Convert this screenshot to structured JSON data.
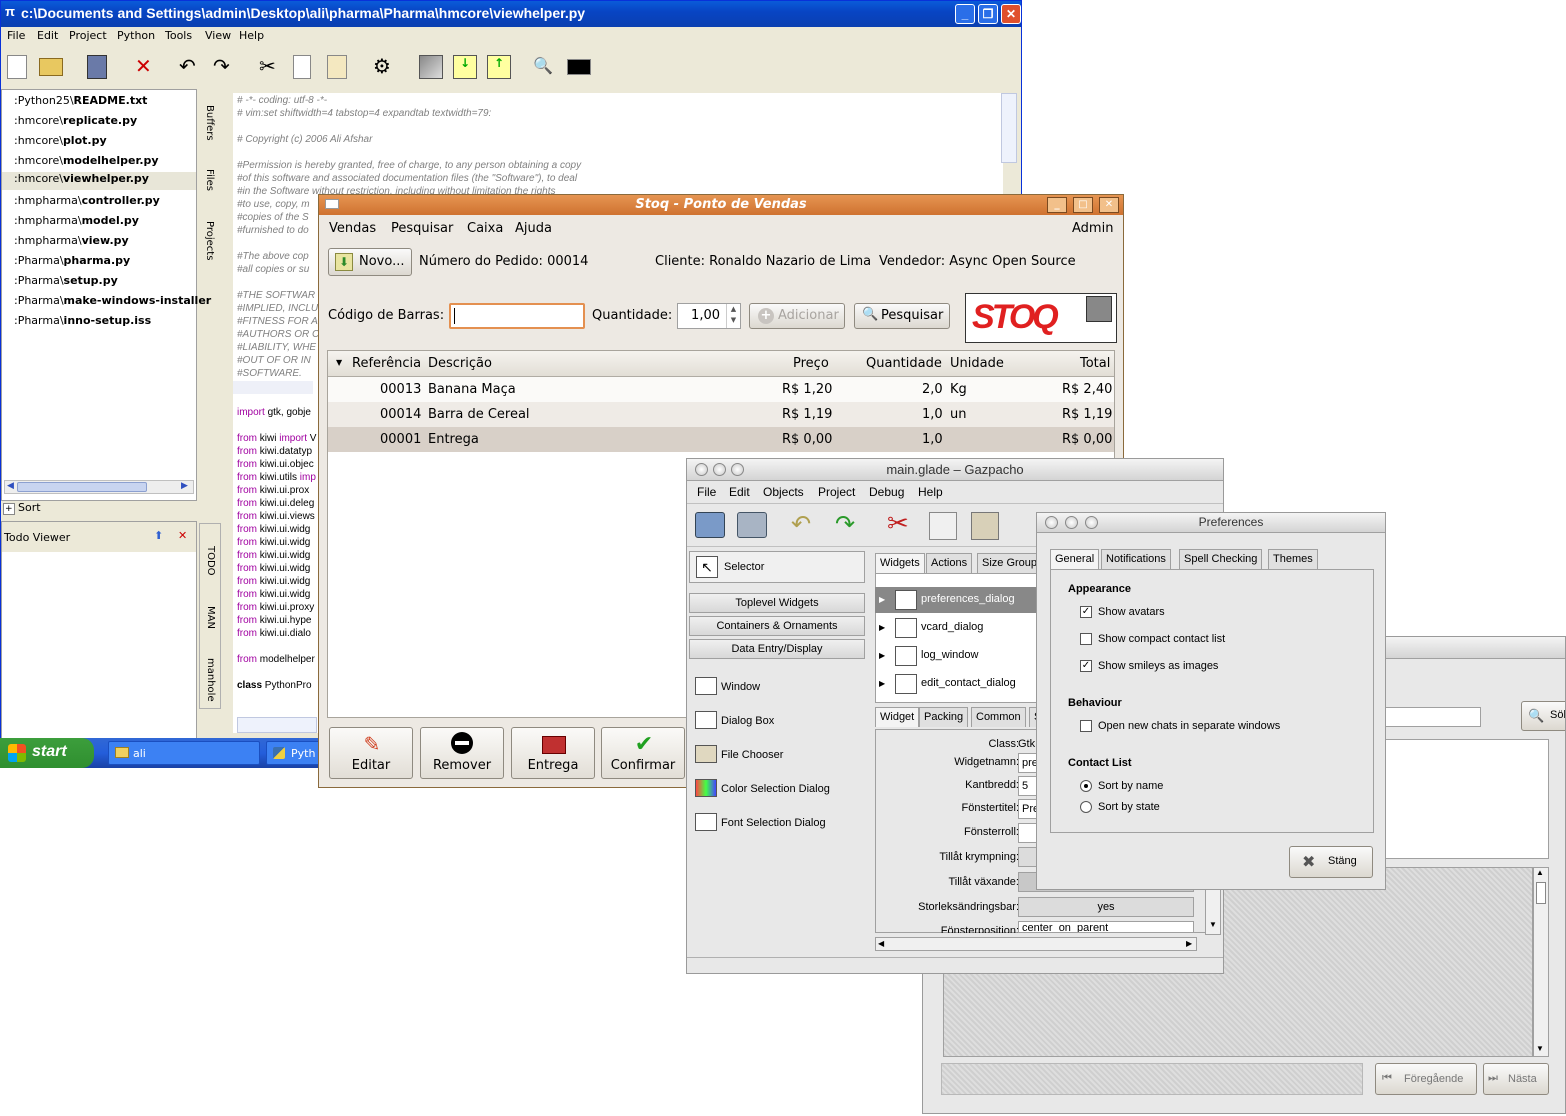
{
  "pida": {
    "title": "c:\\Documents and Settings\\admin\\Desktop\\ali\\pharma\\Pharma\\hmcore\\viewhelper.py",
    "menu": [
      "File",
      "Edit",
      "Project",
      "Python",
      "Tools",
      "View",
      "Help"
    ],
    "files": [
      {
        "dir": ":Python25\\",
        "name": "README.txt"
      },
      {
        "dir": ":hmcore\\",
        "name": "replicate.py"
      },
      {
        "dir": ":hmcore\\",
        "name": "plot.py"
      },
      {
        "dir": ":hmcore\\",
        "name": "modelhelper.py"
      },
      {
        "dir": ":hmcore\\",
        "name": "viewhelper.py"
      },
      {
        "dir": ":hmpharma\\",
        "name": "controller.py"
      },
      {
        "dir": ":hmpharma\\",
        "name": "model.py"
      },
      {
        "dir": ":hmpharma\\",
        "name": "view.py"
      },
      {
        "dir": ":Pharma\\",
        "name": "pharma.py"
      },
      {
        "dir": ":Pharma\\",
        "name": "setup.py"
      },
      {
        "dir": ":Pharma\\",
        "name": "make-windows-installer"
      },
      {
        "dir": ":Pharma\\",
        "name": "inno-setup.iss"
      }
    ],
    "side_tabs_top": [
      "Buffers",
      "Files",
      "Projects"
    ],
    "side_tabs_bottom": [
      "TODO",
      "MAN",
      "manhole"
    ],
    "sort_label": "Sort",
    "todo_title": "Todo Viewer",
    "code_lines": [
      "# -*- coding: utf-8 -*-",
      "# vim:set shiftwidth=4 tabstop=4 expandtab textwidth=79:",
      "",
      "# Copyright (c) 2006 Ali Afshar",
      "",
      "#Permission is hereby granted, free of charge, to any person obtaining a copy",
      "#of this software and associated documentation files (the \"Software\"), to deal",
      "#in the Software without restriction, including without limitation the rights",
      "#to use, copy, m",
      "#copies of the S",
      "#furnished to do",
      "",
      "#The above cop",
      "#all copies or su",
      "",
      "#THE SOFTWAR",
      "#IMPLIED, INCLU",
      "#FITNESS FOR A",
      "#AUTHORS OR C",
      "#LIABILITY, WHE",
      "#OUT OF OR IN",
      "#SOFTWARE."
    ],
    "import_lines": [
      {
        "kw": "import",
        "rest": " gtk, gobje"
      },
      {
        "kw": "",
        "rest": ""
      },
      {
        "kw": "from",
        "rest": " kiwi ",
        "kw2": "import",
        "rest2": " V"
      },
      {
        "kw": "from",
        "rest": " kiwi.datatyp"
      },
      {
        "kw": "from",
        "rest": " kiwi.ui.objec"
      },
      {
        "kw": "from",
        "rest": " kiwi.utils ",
        "kw2": "imp"
      },
      {
        "kw": "from",
        "rest": " kiwi.ui.prox"
      },
      {
        "kw": "from",
        "rest": " kiwi.ui.deleg"
      },
      {
        "kw": "from",
        "rest": " kiwi.ui.views"
      },
      {
        "kw": "from",
        "rest": " kiwi.ui.widg"
      },
      {
        "kw": "from",
        "rest": " kiwi.ui.widg"
      },
      {
        "kw": "from",
        "rest": " kiwi.ui.widg"
      },
      {
        "kw": "from",
        "rest": " kiwi.ui.widg"
      },
      {
        "kw": "from",
        "rest": " kiwi.ui.widg"
      },
      {
        "kw": "from",
        "rest": " kiwi.ui.widg"
      },
      {
        "kw": "from",
        "rest": " kiwi.ui.proxy"
      },
      {
        "kw": "from",
        "rest": " kiwi.ui.hype"
      },
      {
        "kw": "from",
        "rest": " kiwi.ui.dialo"
      },
      {
        "kw": "",
        "rest": ""
      },
      {
        "kw": "from",
        "rest": " modelhelper"
      },
      {
        "kw": "",
        "rest": ""
      },
      {
        "kw": "class",
        "rest": " PythonPro"
      }
    ]
  },
  "taskbar": {
    "start": "start",
    "items": [
      "ali",
      "Pyth"
    ]
  },
  "stoq": {
    "title": "Stoq - Ponto de Vendas",
    "menu": [
      "Vendas",
      "Pesquisar",
      "Caixa",
      "Ajuda"
    ],
    "admin": "Admin",
    "novo": "Novo...",
    "pedido": "Número do Pedido: 00014",
    "cliente": "Cliente: Ronaldo Nazario de Lima",
    "vendedor": "Vendedor: Async Open Source",
    "barcode_label": "Código de Barras:",
    "qty_label": "Quantidade:",
    "qty_value": "1,00",
    "adicionar": "Adicionar",
    "pesquisar": "Pesquisar",
    "logo": "STOQ",
    "columns": [
      "Referência",
      "Descrição",
      "Preço",
      "Quantidade",
      "Unidade",
      "Total"
    ],
    "rows": [
      {
        "ref": "00013",
        "desc": "Banana Maça",
        "preco": "R$ 1,20",
        "qtd": "2,0",
        "un": "Kg",
        "total": "R$ 2,40"
      },
      {
        "ref": "00014",
        "desc": "Barra de Cereal",
        "preco": "R$ 1,19",
        "qtd": "1,0",
        "un": "un",
        "total": "R$ 1,19"
      },
      {
        "ref": "00001",
        "desc": "Entrega",
        "preco": "R$ 0,00",
        "qtd": "1,0",
        "un": "",
        "total": "R$ 0,00"
      }
    ],
    "actions": [
      "Editar",
      "Remover",
      "Entrega",
      "Confirmar"
    ]
  },
  "glade": {
    "title": "main.glade – Gazpacho",
    "menu": [
      "File",
      "Edit",
      "Objects",
      "Project",
      "Debug",
      "Help"
    ],
    "selector": "Selector",
    "palette_groups": [
      "Toplevel Widgets",
      "Containers & Ornaments",
      "Data Entry/Display"
    ],
    "palette_items": [
      "Window",
      "Dialog Box",
      "File Chooser",
      "Color Selection Dialog",
      "Font Selection Dialog"
    ],
    "tree_tabs": [
      "Widgets",
      "Actions",
      "Size Group"
    ],
    "tree_items": [
      "preferences_dialog",
      "vcard_dialog",
      "log_window",
      "edit_contact_dialog"
    ],
    "editor_tabs": [
      "Widget",
      "Packing",
      "Common",
      "S"
    ],
    "properties": [
      {
        "label": "Class:",
        "value": "Gtk"
      },
      {
        "label": "Widgetnamn:",
        "value": "pre"
      },
      {
        "label": "Kantbredd:",
        "value": "5"
      },
      {
        "label": "Fönstertitel:",
        "value": "Pre"
      },
      {
        "label": "Fönsterroll:",
        "value": ""
      },
      {
        "label": "Tillåt krympning:",
        "value": ""
      },
      {
        "label": "Tillåt växande:",
        "value": ""
      },
      {
        "label": "Storleksändringsbar:",
        "value": "yes"
      },
      {
        "label": "Fönsterposition:",
        "value": "center_on_parent"
      }
    ]
  },
  "prefs": {
    "title": "Preferences",
    "tabs": [
      "General",
      "Notifications",
      "Spell Checking",
      "Themes"
    ],
    "appearance": "Appearance",
    "show_avatars": "Show avatars",
    "show_compact": "Show compact contact list",
    "show_smileys": "Show smileys as images",
    "behaviour": "Behaviour",
    "open_new": "Open new chats in separate windows",
    "contact_list": "Contact List",
    "sort_name": "Sort by name",
    "sort_state": "Sort by state",
    "close": "Stäng"
  },
  "backwin": {
    "search": "Sök",
    "prev": "Föregående",
    "next": "Nästa"
  }
}
